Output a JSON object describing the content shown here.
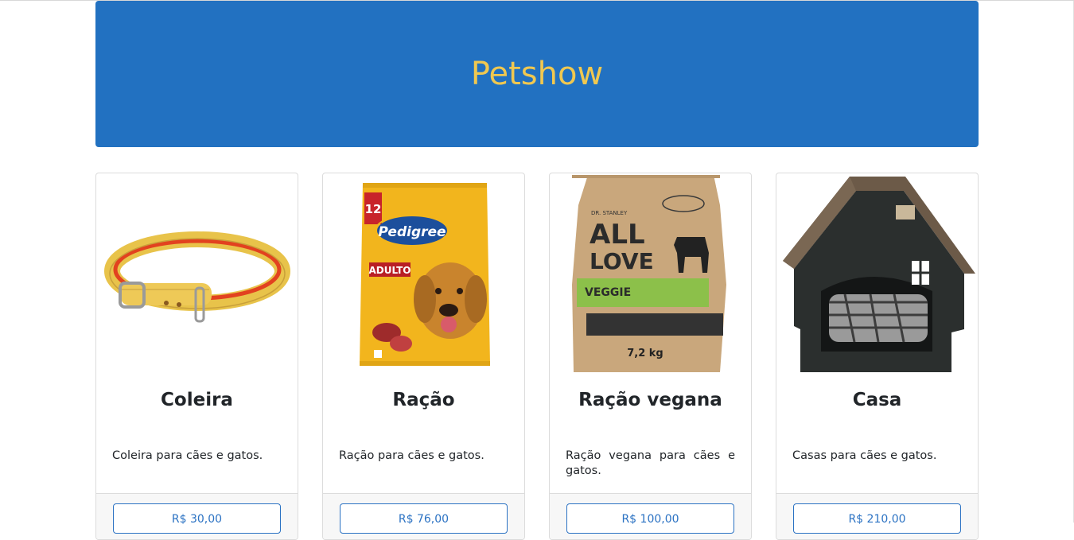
{
  "header": {
    "title": "Petshow"
  },
  "products": [
    {
      "name": "Coleira",
      "description": "Coleira para cães e gatos.",
      "price": "R$ 30,00"
    },
    {
      "name": "Ração",
      "description": "Ração para cães e gatos.",
      "price": "R$ 76,00"
    },
    {
      "name": "Ração vegana",
      "description": "Ração vegana para cães e gatos.",
      "price": "R$ 100,00"
    },
    {
      "name": "Casa",
      "description": "Casas para cães e gatos.",
      "price": "R$ 210,00"
    }
  ],
  "images": {
    "kibble_bag_text": "Pedigree",
    "kibble_bag_badge": "ADULTO",
    "kibble_bag_age": "12",
    "vegan_bag_brand": "DR. STANLEY",
    "vegan_bag_title_1": "ALL",
    "vegan_bag_title_2": "LOVE",
    "vegan_bag_veggie": "VEGGIE",
    "vegan_bag_weight": "7,2 kg"
  },
  "colors": {
    "header_bg": "#2271c1",
    "header_text": "#f0c850",
    "accent": "#2b72c3"
  }
}
